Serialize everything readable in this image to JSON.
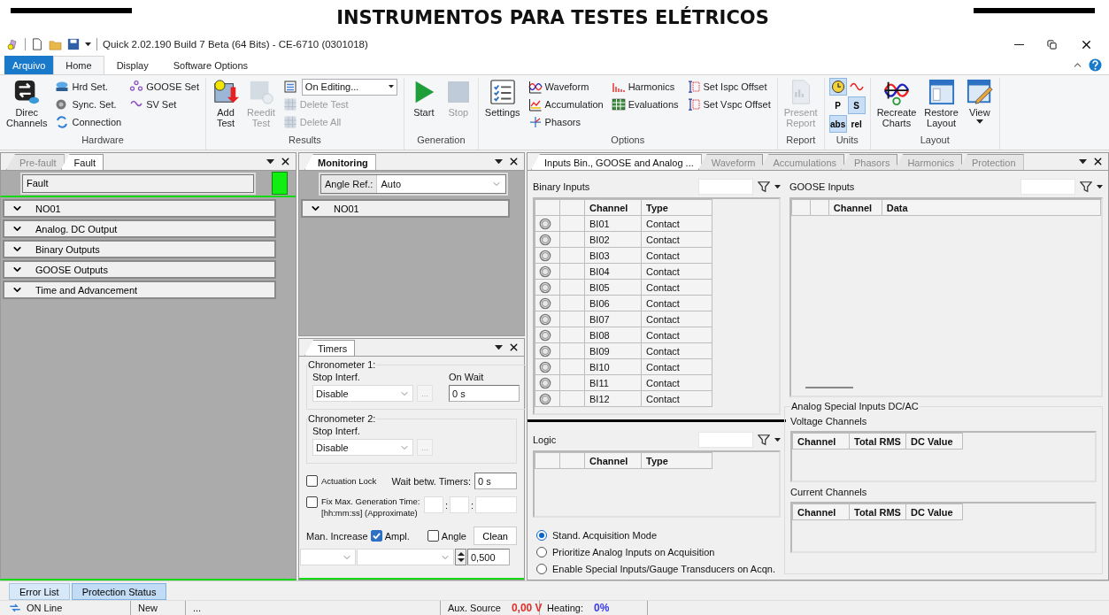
{
  "banner": {
    "title": "INSTRUMENTOS PARA TESTES ELÉTRICOS"
  },
  "window": {
    "title": "Quick 2.02.190 Build 7 Beta (64 Bits) - CE-6710 (0301018)"
  },
  "ribbon_tabs": [
    {
      "label": "Arquivo",
      "kind": "file",
      "selected": false
    },
    {
      "label": "Home",
      "kind": "tab",
      "selected": true
    },
    {
      "label": "Display",
      "kind": "tab",
      "selected": false
    },
    {
      "label": "Software Options",
      "kind": "tab",
      "selected": false
    }
  ],
  "ribbon": [
    {
      "label": "Hardware",
      "items": [
        {
          "kind": "large",
          "label": "Direc Channels",
          "disabled": false
        },
        {
          "kind": "stack",
          "items": [
            {
              "kind": "button",
              "label": "Hrd Set.",
              "disabled": false
            },
            {
              "kind": "button",
              "label": "Sync. Set.",
              "disabled": false
            },
            {
              "kind": "button",
              "label": "Connection",
              "disabled": false
            }
          ]
        },
        {
          "kind": "stack",
          "items": [
            {
              "kind": "button",
              "label": "GOOSE Set",
              "disabled": false
            },
            {
              "kind": "button",
              "label": "SV Set",
              "disabled": false
            }
          ]
        }
      ]
    },
    {
      "label": "Results",
      "items": [
        {
          "kind": "large",
          "label": "Add Test",
          "disabled": false
        },
        {
          "kind": "large",
          "label": "Reedit Test",
          "disabled": true
        },
        {
          "kind": "stack",
          "items": [
            {
              "kind": "combo",
              "value": "On Editing...",
              "disabled": false
            },
            {
              "kind": "button",
              "label": "Delete Test",
              "disabled": true
            },
            {
              "kind": "button",
              "label": "Delete All",
              "disabled": true
            }
          ]
        }
      ]
    },
    {
      "label": "Generation",
      "items": [
        {
          "kind": "large",
          "label": "Start",
          "disabled": false
        },
        {
          "kind": "large",
          "label": "Stop",
          "disabled": true
        }
      ]
    },
    {
      "label": "Options",
      "items": [
        {
          "kind": "large",
          "label": "Settings",
          "disabled": false
        },
        {
          "kind": "stack",
          "items": [
            {
              "kind": "button",
              "label": "Waveform",
              "disabled": false
            },
            {
              "kind": "button",
              "label": "Accumulation",
              "disabled": false
            },
            {
              "kind": "button",
              "label": "Phasors",
              "disabled": false
            }
          ]
        },
        {
          "kind": "stack",
          "items": [
            {
              "kind": "button",
              "label": "Harmonics",
              "disabled": false
            },
            {
              "kind": "button",
              "label": "Evaluations",
              "disabled": false
            }
          ]
        },
        {
          "kind": "stack",
          "items": [
            {
              "kind": "button",
              "label": "Set Ispc Offset",
              "disabled": false
            },
            {
              "kind": "button",
              "label": "Set Vspc Offset",
              "disabled": false
            }
          ]
        }
      ]
    },
    {
      "label": "Report",
      "items": [
        {
          "kind": "large",
          "label": "Present Report",
          "disabled": true
        }
      ]
    },
    {
      "label": "Units",
      "items": [
        {
          "kind": "units",
          "cells": [
            {
              "kind": "clock",
              "selected": true
            },
            {
              "kind": "wave",
              "selected": false
            },
            {
              "kind": "text",
              "label": "P",
              "selected": false
            },
            {
              "kind": "text",
              "label": "S",
              "selected": true
            },
            {
              "kind": "text",
              "label": "abs",
              "selected": true
            },
            {
              "kind": "text",
              "label": "rel",
              "selected": false
            }
          ]
        }
      ]
    },
    {
      "label": "Layout",
      "items": [
        {
          "kind": "large",
          "label": "Recreate Charts",
          "disabled": false
        },
        {
          "kind": "large",
          "label": "Restore Layout",
          "disabled": false
        },
        {
          "kind": "large",
          "label": "View",
          "disabled": false,
          "caret": true
        }
      ]
    }
  ],
  "left_panel": {
    "tabs": [
      {
        "label": "Pre-fault",
        "selected": false
      },
      {
        "label": "Fault",
        "selected": true
      }
    ],
    "name_field": "Fault",
    "sections": [
      {
        "label": "NO01",
        "expanded": false
      },
      {
        "label": "Analog. DC Output",
        "expanded": false
      },
      {
        "label": "Binary Outputs",
        "expanded": false
      },
      {
        "label": "GOOSE Outputs",
        "expanded": false
      },
      {
        "label": "Time and Advancement",
        "expanded": false
      }
    ]
  },
  "monitoring": {
    "tabs": [
      {
        "label": "Monitoring",
        "selected": true
      }
    ],
    "angle_ref_label": "Angle Ref.:",
    "angle_ref_value": "Auto",
    "sections": [
      {
        "label": "NO01",
        "expanded": false
      }
    ]
  },
  "timers": {
    "tabs": [
      {
        "label": "Timers",
        "selected": true
      }
    ],
    "chronometers": [
      {
        "title": "Chronometer 1:",
        "stop_label": "Stop Interf.",
        "stop_value": "Disable",
        "browse": "...",
        "wait_label": "On Wait",
        "wait_value": "0 s"
      },
      {
        "title": "Chronometer 2:",
        "stop_label": "Stop Interf.",
        "stop_value": "Disable",
        "browse": "..."
      }
    ],
    "actuation_lock": {
      "label": "Actuation Lock",
      "checked": false
    },
    "wait_between": {
      "label": "Wait betw. Timers:",
      "value": "0 s"
    },
    "fix_time": {
      "label": "Fix Max. Generation Time:",
      "note": "[hh:mm:ss] (Approximate)",
      "checked": false,
      "separators": [
        ":",
        ":"
      ]
    },
    "man_increase": {
      "label": "Man. Increase",
      "ampl": {
        "label": "Ampl.",
        "checked": true
      },
      "angle": {
        "label": "Angle",
        "checked": false
      },
      "clean": "Clean",
      "step": "0,500"
    }
  },
  "inputs_panel": {
    "tabs": [
      {
        "label": "Inputs Bin., GOOSE and Analog ...",
        "selected": true
      },
      {
        "label": "Waveform",
        "selected": false
      },
      {
        "label": "Accumulations",
        "selected": false
      },
      {
        "label": "Phasors",
        "selected": false
      },
      {
        "label": "Harmonics",
        "selected": false
      },
      {
        "label": "Protection",
        "selected": false
      }
    ],
    "binary_inputs": {
      "title": "Binary Inputs",
      "columns": [
        "Channel",
        "Type"
      ],
      "rows": [
        {
          "channel": "BI01",
          "type": "Contact"
        },
        {
          "channel": "BI02",
          "type": "Contact"
        },
        {
          "channel": "BI03",
          "type": "Contact"
        },
        {
          "channel": "BI04",
          "type": "Contact"
        },
        {
          "channel": "BI05",
          "type": "Contact"
        },
        {
          "channel": "BI06",
          "type": "Contact"
        },
        {
          "channel": "BI07",
          "type": "Contact"
        },
        {
          "channel": "BI08",
          "type": "Contact"
        },
        {
          "channel": "BI09",
          "type": "Contact"
        },
        {
          "channel": "BI10",
          "type": "Contact"
        },
        {
          "channel": "BI11",
          "type": "Contact"
        },
        {
          "channel": "BI12",
          "type": "Contact"
        }
      ]
    },
    "goose_inputs": {
      "title": "GOOSE Inputs",
      "columns": [
        "Channel",
        "Data"
      ]
    },
    "logic": {
      "title": "Logic",
      "columns": [
        "Channel",
        "Type"
      ]
    },
    "acquisition_modes": [
      {
        "label": "Stand. Acquisition Mode",
        "selected": true
      },
      {
        "label": "Prioritize Analog Inputs on Acquisition",
        "selected": false
      },
      {
        "label": "Enable Special Inputs/Gauge Transducers on Acqn.",
        "selected": false
      }
    ],
    "analog_special": {
      "title": "Analog Special Inputs DC/AC",
      "groups": [
        {
          "title": "Voltage Channels",
          "columns": [
            "Channel",
            "Total RMS",
            "DC Value"
          ]
        },
        {
          "title": "Current Channels",
          "columns": [
            "Channel",
            "Total RMS",
            "DC Value"
          ]
        }
      ]
    }
  },
  "bottom_tabs": [
    {
      "label": "Error List",
      "selected": false
    },
    {
      "label": "Protection Status",
      "selected": true
    }
  ],
  "status_bar": [
    {
      "kind": "connection",
      "label": "ON Line"
    },
    {
      "kind": "text",
      "label": "New"
    },
    {
      "kind": "text",
      "label": "..."
    },
    {
      "kind": "reading",
      "label": "Aux. Source",
      "value": "0,00 V",
      "color": "#e0302a"
    },
    {
      "kind": "reading",
      "label": "Heating:",
      "value": "0%",
      "color": "#3a3af0"
    }
  ]
}
